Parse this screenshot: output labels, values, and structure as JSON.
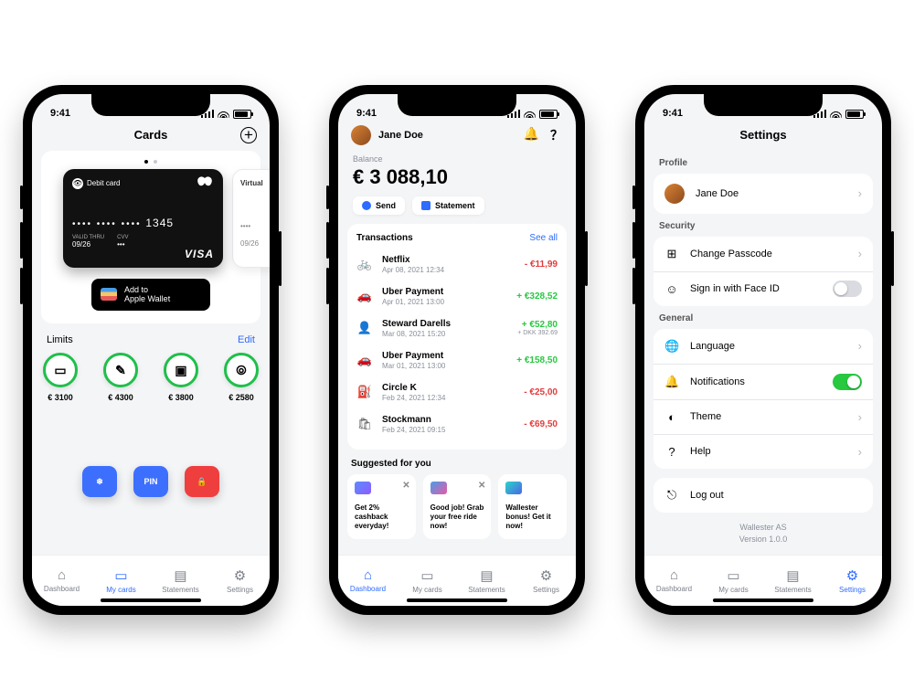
{
  "status_time": "9:41",
  "tabs": {
    "dashboard": "Dashboard",
    "mycards": "My cards",
    "statements": "Statements",
    "settings": "Settings"
  },
  "cards_phone": {
    "title": "Cards",
    "card": {
      "type": "Debit card",
      "masked": "•••• •••• ••••",
      "last4": "1345",
      "valid_thru_label": "VALID THRU",
      "valid_thru": "09/26",
      "cvv_label": "CVV",
      "cvv": "•••",
      "brand": "VISA"
    },
    "virtual_card": {
      "type": "Virtual",
      "masked": "••••",
      "valid_thru": "09/26"
    },
    "wallet_btn_line1": "Add to",
    "wallet_btn_line2": "Apple Wallet",
    "limits_title": "Limits",
    "edit_label": "Edit",
    "limits": [
      {
        "amount": "€ 3100"
      },
      {
        "amount": "€ 4300"
      },
      {
        "amount": "€ 3800"
      },
      {
        "amount": "€ 2580"
      }
    ],
    "pin_label": "PIN"
  },
  "dashboard_phone": {
    "user_name": "Jane Doe",
    "balance_label": "Balance",
    "balance": "€ 3 088,10",
    "send_label": "Send",
    "statement_label": "Statement",
    "tx_title": "Transactions",
    "see_all": "See all",
    "transactions": [
      {
        "name": "Netflix",
        "date": "Apr 08, 2021  12:34",
        "amount": "- €11,99",
        "cls": "neg"
      },
      {
        "name": "Uber Payment",
        "date": "Apr 01, 2021  13:00",
        "amount": "+ €328,52",
        "cls": "pos"
      },
      {
        "name": "Steward Darells",
        "date": "Mar 08, 2021  15:20",
        "amount": "+ €52,80",
        "sub": "+ DKK 392.69",
        "cls": "pos"
      },
      {
        "name": "Uber Payment",
        "date": "Mar 01, 2021  13:00",
        "amount": "+ €158,50",
        "cls": "pos"
      },
      {
        "name": "Circle K",
        "date": "Feb 24, 2021  12:34",
        "amount": "- €25,00",
        "cls": "neg"
      },
      {
        "name": "Stockmann",
        "date": "Feb 24, 2021  09:15",
        "amount": "- €69,50",
        "cls": "neg"
      }
    ],
    "sugg_title": "Suggested for you",
    "suggestions": [
      {
        "text": "Get 2% cashback everyday!"
      },
      {
        "text": "Good job! Grab your free ride now!"
      },
      {
        "text": "Wallester bonus! Get it now!"
      }
    ]
  },
  "settings_phone": {
    "title": "Settings",
    "profile_label": "Profile",
    "user_name": "Jane Doe",
    "security_label": "Security",
    "passcode": "Change Passcode",
    "faceid": "Sign in with Face ID",
    "general_label": "General",
    "language": "Language",
    "notifications": "Notifications",
    "theme": "Theme",
    "help": "Help",
    "logout": "Log out",
    "company": "Wallester AS",
    "version": "Version 1.0.0"
  }
}
